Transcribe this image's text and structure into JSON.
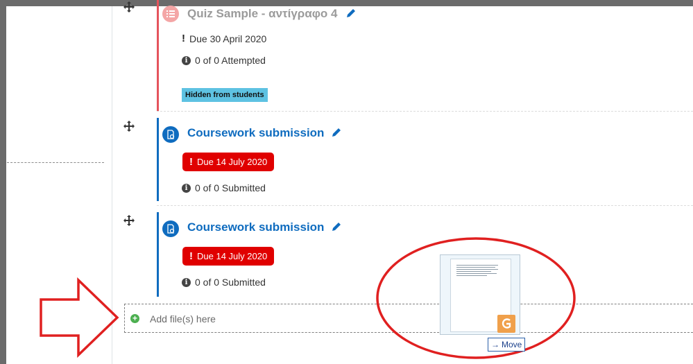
{
  "activities": [
    {
      "title": "Quiz Sample - αντίγραφο 4",
      "icon": "quiz-list-icon",
      "due_text": "Due 30 April 2020",
      "status_text": "0 of 0 Attempted",
      "badge": "Hidden from students",
      "accent_color": "#e5545c"
    },
    {
      "title": "Coursework submission",
      "icon": "assignment-icon",
      "due_text": "Due 14 July 2020",
      "status_text": "0 of 0 Submitted",
      "accent_color": "#0f6cbf"
    },
    {
      "title": "Coursework submission",
      "icon": "assignment-icon",
      "due_text": "Due 14 July 2020",
      "status_text": "0 of 0 Submitted",
      "accent_color": "#0f6cbf"
    }
  ],
  "dropzone": {
    "label": "Add file(s) here"
  },
  "drag": {
    "tooltip": "Move",
    "file_badge_icon": "file-type-icon"
  },
  "annotations": {
    "arrow_color": "#e02020",
    "ellipse_color": "#e02020"
  },
  "colors": {
    "link": "#0f6cbf",
    "danger": "#e00000",
    "info_badge": "#5ec2e2"
  }
}
